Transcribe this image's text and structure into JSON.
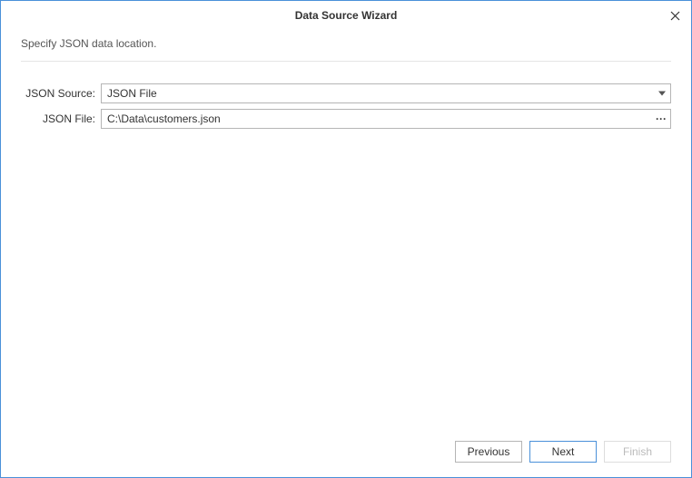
{
  "dialog": {
    "title": "Data Source Wizard",
    "subtitle": "Specify JSON data location."
  },
  "form": {
    "source_label": "JSON Source:",
    "source_value": "JSON File",
    "file_label": "JSON File:",
    "file_value": "C:\\Data\\customers.json"
  },
  "buttons": {
    "previous": "Previous",
    "next": "Next",
    "finish": "Finish"
  }
}
